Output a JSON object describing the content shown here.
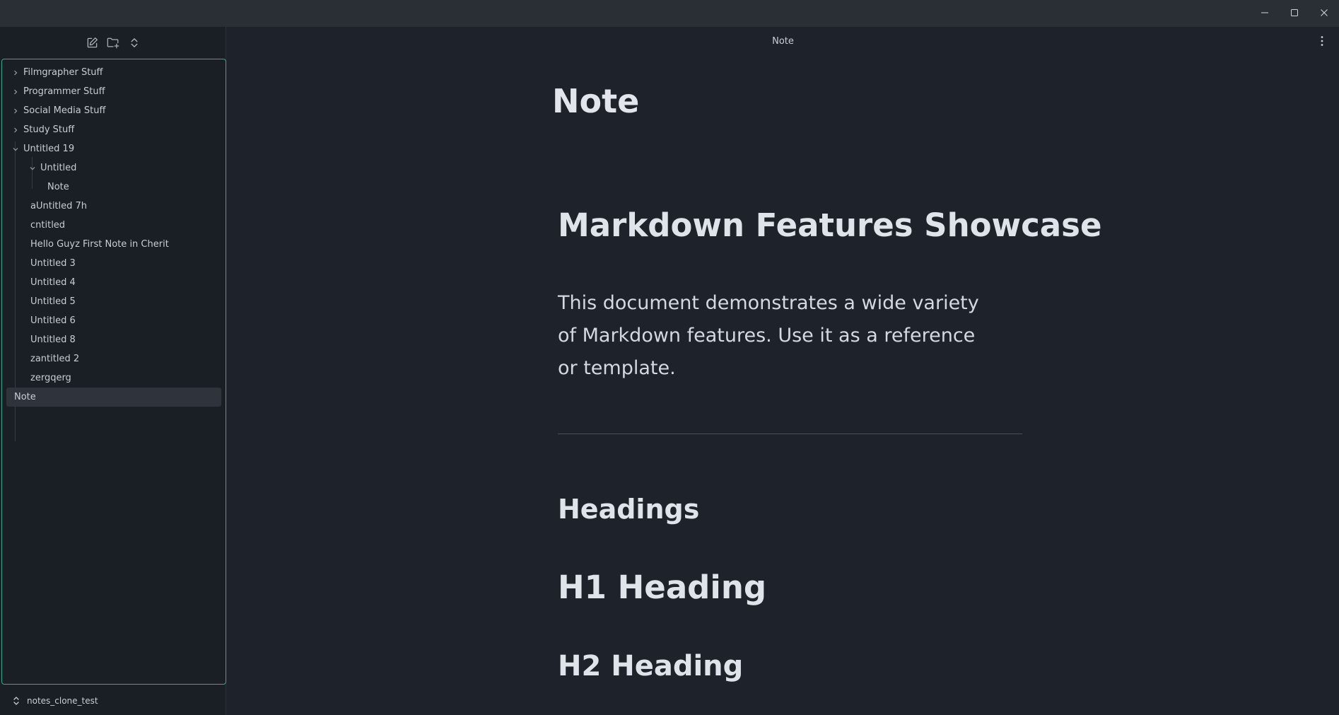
{
  "window": {
    "minimize_icon": "minimize-icon",
    "maximize_icon": "maximize-icon",
    "close_icon": "close-icon"
  },
  "sidebar": {
    "toolbar_icons": [
      "new-note-icon",
      "new-folder-icon",
      "expand-collapse-icon"
    ],
    "tree": [
      {
        "label": "Filmgrapher Stuff",
        "type": "folder",
        "expanded": false
      },
      {
        "label": "Programmer Stuff",
        "type": "folder",
        "expanded": false
      },
      {
        "label": "Social Media Stuff",
        "type": "folder",
        "expanded": false
      },
      {
        "label": "Study Stuff",
        "type": "folder",
        "expanded": false
      },
      {
        "label": "Untitled 19",
        "type": "folder",
        "expanded": true
      },
      {
        "label": "Untitled",
        "type": "folder",
        "expanded": true
      },
      {
        "label": "Note",
        "type": "note"
      },
      {
        "label": "aUntitled 7h",
        "type": "note"
      },
      {
        "label": "cntitled",
        "type": "note"
      },
      {
        "label": "Hello Guyz First Note in Cherit",
        "type": "note"
      },
      {
        "label": "Untitled 3",
        "type": "note"
      },
      {
        "label": "Untitled 4",
        "type": "note"
      },
      {
        "label": "Untitled 5",
        "type": "note"
      },
      {
        "label": "Untitled 6",
        "type": "note"
      },
      {
        "label": "Untitled 8",
        "type": "note"
      },
      {
        "label": "zantitled 2",
        "type": "note"
      },
      {
        "label": "zergqerg",
        "type": "note"
      },
      {
        "label": "Note",
        "type": "note",
        "selected": true
      }
    ],
    "vault_name": "notes_clone_test"
  },
  "main": {
    "tab_title": "Note",
    "note_title": "Note",
    "heading_showcase": "Markdown Features Showcase",
    "paragraph": "This document demonstrates a wide variety of Markdown features. Use it as a reference or template.",
    "heading_headings": "Headings",
    "heading_h1": "H1 Heading",
    "heading_h2": "H2 Heading"
  },
  "colors": {
    "accent": "#3aa88f",
    "background": "#1e232b",
    "sidebar": "#1a1e25"
  }
}
